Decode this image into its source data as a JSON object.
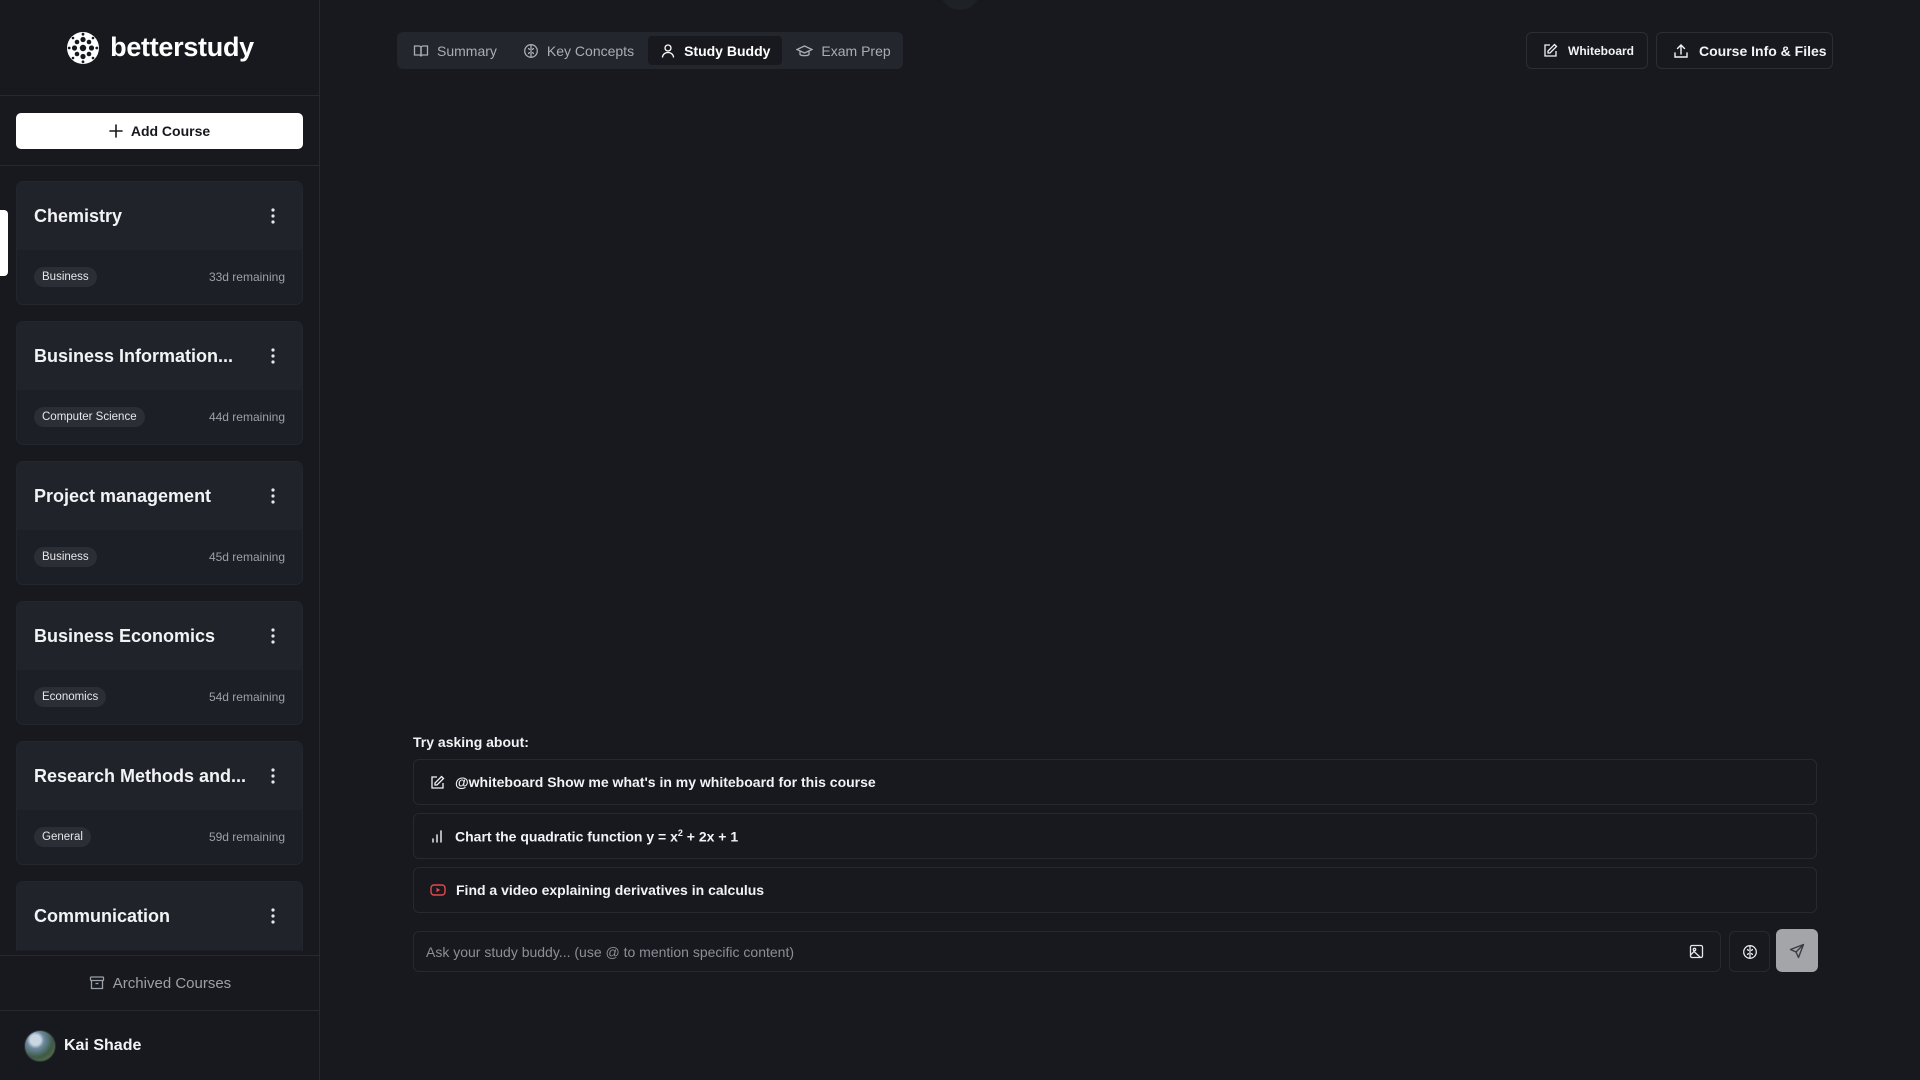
{
  "app": {
    "name": "betterstudy"
  },
  "sidebar": {
    "add_course_label": "Add Course",
    "courses": [
      {
        "title": "Chemistry",
        "tag": "Business",
        "remaining": "33d remaining",
        "active": true
      },
      {
        "title": "Business Information...",
        "tag": "Computer Science",
        "remaining": "44d remaining"
      },
      {
        "title": "Project management",
        "tag": "Business",
        "remaining": "45d remaining"
      },
      {
        "title": "Business Economics",
        "tag": "Economics",
        "remaining": "54d remaining"
      },
      {
        "title": "Research Methods and...",
        "tag": "General",
        "remaining": "59d remaining"
      },
      {
        "title": "Communication",
        "tag": "",
        "remaining": ""
      }
    ],
    "archived_label": "Archived Courses",
    "user_name": "Kai Shade"
  },
  "tabs": [
    {
      "label": "Summary",
      "icon": "book-icon"
    },
    {
      "label": "Key Concepts",
      "icon": "brain-icon"
    },
    {
      "label": "Study Buddy",
      "icon": "user-icon",
      "active": true
    },
    {
      "label": "Exam Prep",
      "icon": "graduation-cap-icon"
    }
  ],
  "toolbar": {
    "whiteboard_label": "Whiteboard",
    "course_info_label": "Course Info & Files"
  },
  "chat": {
    "try_label": "Try asking about:",
    "suggestions": [
      {
        "text": "@whiteboard Show me what's in my whiteboard for this course",
        "icon": "edit-icon"
      },
      {
        "text_before": "Chart the quadratic function y = x",
        "sup": "2",
        "text_after": " + 2x + 1",
        "icon": "bar-chart-icon"
      },
      {
        "text": "Find a video explaining derivatives in calculus",
        "icon": "youtube-icon"
      }
    ],
    "input_placeholder": "Ask your study buddy... (use @ to mention specific content)"
  },
  "colors": {
    "background": "#17191e",
    "card": "#1c1f25",
    "card_header": "#20232a",
    "accent_white": "#ffffff",
    "send_button": "#a3a5a9",
    "youtube_red": "#e5484d"
  }
}
